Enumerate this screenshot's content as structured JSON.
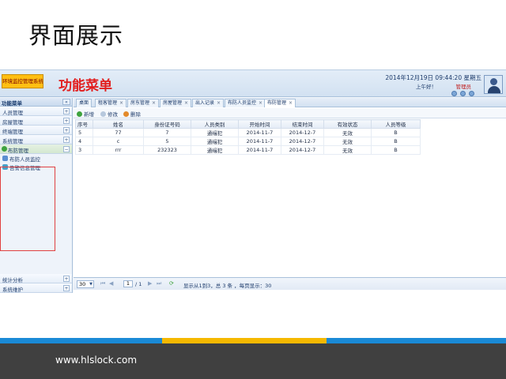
{
  "slide": {
    "title": "界面展示",
    "footer_url": "www.hlslock.com"
  },
  "header": {
    "logo_text": "环境监控管理系统",
    "menu_annotation": "功能菜单",
    "datetime": "2014年12月19日 09:44:20 星期五",
    "greeting": "上午好！",
    "role": "管理员"
  },
  "sidebar": {
    "title": "功能菜单",
    "collapse": "«",
    "groups": [
      {
        "label": "人员管理",
        "toggle": "+"
      },
      {
        "label": "房屋管理",
        "toggle": "+"
      },
      {
        "label": "终端管理",
        "toggle": "+"
      },
      {
        "label": "系统管理",
        "toggle": "+"
      },
      {
        "label": "布防管理",
        "toggle": "−"
      }
    ],
    "subitems": [
      "布防人员监控",
      "告警信息管理"
    ],
    "bottom_groups": [
      {
        "label": "统计分析",
        "toggle": "+"
      },
      {
        "label": "系统维护",
        "toggle": "+"
      }
    ]
  },
  "tabs": [
    {
      "label": "桌面",
      "closable": false
    },
    {
      "label": "租客管理",
      "closable": true
    },
    {
      "label": "房东管理",
      "closable": true
    },
    {
      "label": "房屋管理",
      "closable": true
    },
    {
      "label": "出入记录",
      "closable": true
    },
    {
      "label": "布防人员监控",
      "closable": true
    },
    {
      "label": "布防管理",
      "closable": true
    }
  ],
  "toolbar": {
    "add": "新增",
    "edit": "修改",
    "delete": "删除"
  },
  "table": {
    "columns": [
      "序号",
      "姓名",
      "身份证号码",
      "人员类别",
      "开始时间",
      "结束时间",
      "有效状态",
      "人员等级"
    ],
    "rows": [
      [
        "5",
        "77",
        "7",
        "通缉犯",
        "2014-11-7",
        "2014-12-7",
        "无效",
        "B"
      ],
      [
        "4",
        "c",
        "5",
        "通缉犯",
        "2014-11-7",
        "2014-12-7",
        "无效",
        "B"
      ],
      [
        "3",
        "rrr",
        "232323",
        "通缉犯",
        "2014-11-7",
        "2014-12-7",
        "无效",
        "B"
      ]
    ]
  },
  "pager": {
    "page_size": "30",
    "page_input": "1",
    "page_total": "/ 1",
    "summary": "显示从1到3，总 3 条 ，每页显示：30"
  },
  "colors": {
    "accent_red": "#e21e1e",
    "stripe_blue": "#1a8ad6",
    "stripe_yellow": "#f5b800",
    "footer": "#404040"
  }
}
